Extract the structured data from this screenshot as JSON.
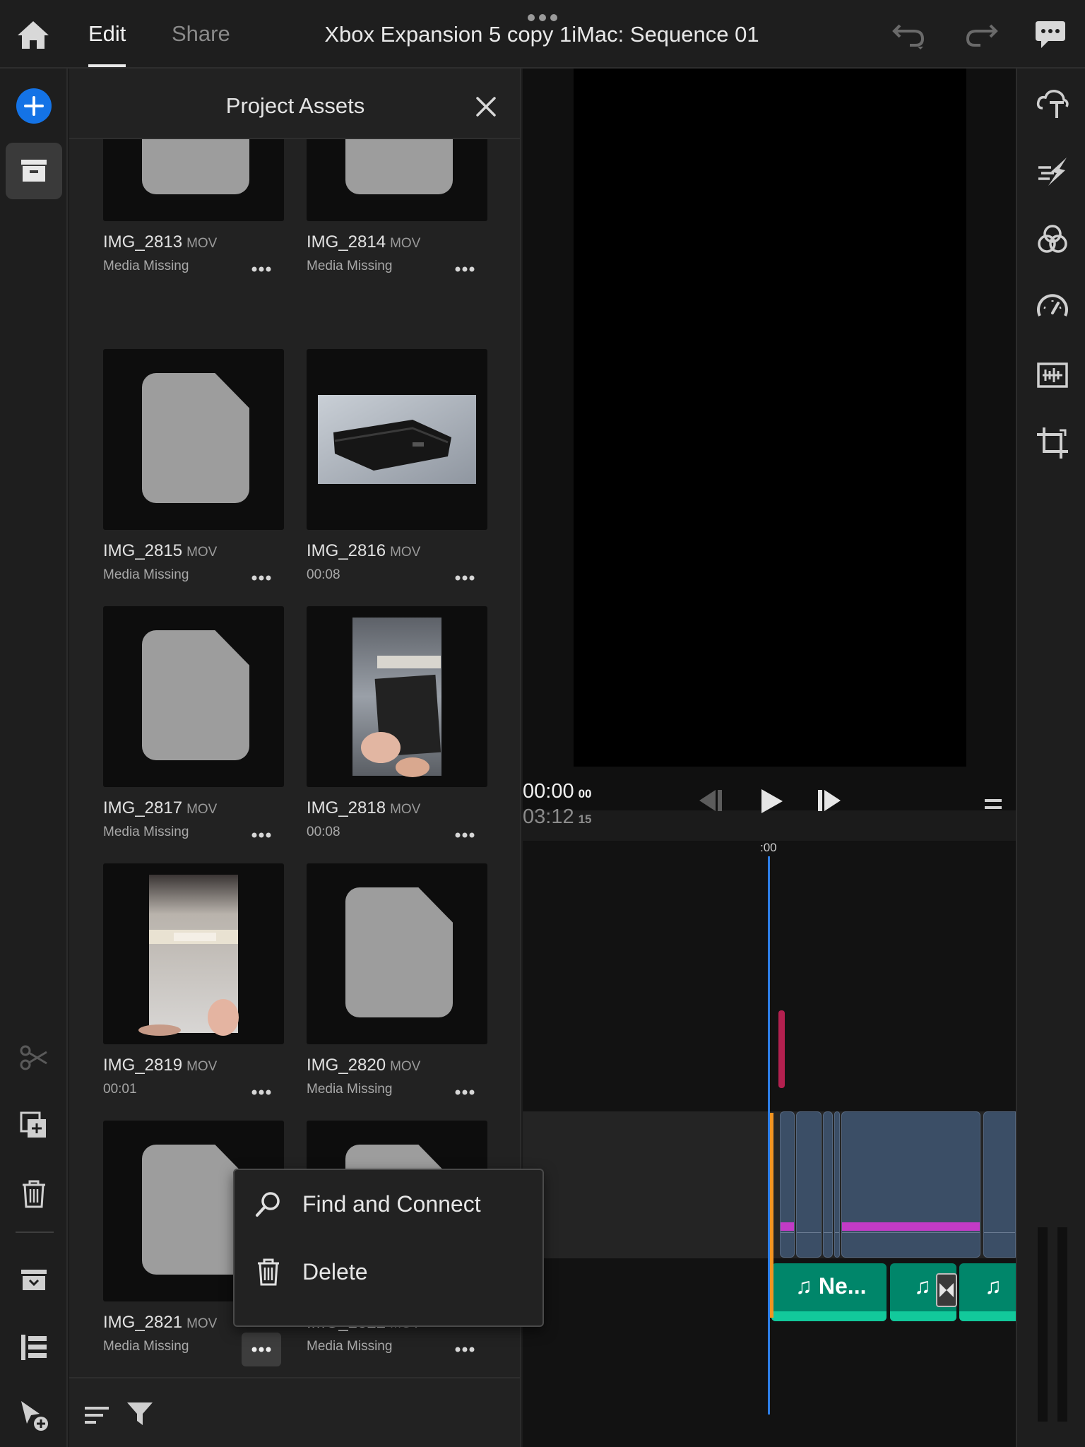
{
  "topbar": {
    "tabs": [
      {
        "label": "Edit",
        "active": true
      },
      {
        "label": "Share",
        "active": false
      }
    ],
    "title": "Xbox Expansion 5 copy 1iMac: Sequence 01",
    "icons": [
      "home-icon",
      "more-dots-icon",
      "undo-icon",
      "redo-icon",
      "feedback-icon"
    ]
  },
  "left_rail": {
    "icons": [
      "add-icon",
      "project-assets-icon",
      "split-scissors-icon",
      "duplicate-icon",
      "delete-icon",
      "collapse-tracks-icon",
      "track-list-icon",
      "select-add-icon"
    ]
  },
  "assets_panel": {
    "title": "Project Assets",
    "items": [
      {
        "name": "IMG_2813",
        "type": "MOV",
        "status": "Media Missing",
        "thumb": "missing"
      },
      {
        "name": "IMG_2814",
        "type": "MOV",
        "status": "Media Missing",
        "thumb": "missing"
      },
      {
        "name": "IMG_2815",
        "type": "MOV",
        "status": "Media Missing",
        "thumb": "missing"
      },
      {
        "name": "IMG_2816",
        "type": "MOV",
        "status": "00:08",
        "thumb": "photo-device"
      },
      {
        "name": "IMG_2817",
        "type": "MOV",
        "status": "Media Missing",
        "thumb": "missing"
      },
      {
        "name": "IMG_2818",
        "type": "MOV",
        "status": "00:08",
        "thumb": "photo-hand-card"
      },
      {
        "name": "IMG_2819",
        "type": "MOV",
        "status": "00:01",
        "thumb": "photo-white"
      },
      {
        "name": "IMG_2820",
        "type": "MOV",
        "status": "Media Missing",
        "thumb": "missing"
      },
      {
        "name": "IMG_2821",
        "type": "MOV",
        "status": "Media Missing",
        "thumb": "missing"
      },
      {
        "name": "IMG_2822",
        "type": "MOV",
        "status": "Media Missing",
        "thumb": "missing"
      }
    ],
    "footer_icons": [
      "sort-icon",
      "filter-icon"
    ]
  },
  "context_menu": {
    "items": [
      {
        "label": "Find and Connect",
        "icon": "search-icon"
      },
      {
        "label": "Delete",
        "icon": "trash-icon"
      }
    ]
  },
  "viewer": {
    "timecode_current": "00:00",
    "timecode_current_frames": "00",
    "timecode_duration": "03:12",
    "timecode_duration_frames": "15"
  },
  "timeline": {
    "ruler_label": ":00",
    "audio_clips": [
      "Ne...",
      "",
      ""
    ]
  },
  "right_rail": {
    "icons": [
      "titles-icon",
      "transitions-icon",
      "color-icon",
      "speed-icon",
      "audio-icon",
      "crop-icon"
    ]
  },
  "colors": {
    "accent_blue": "#1473e6",
    "clip_video": "#3b4e66",
    "clip_audio": "#00866a",
    "playhead": "#2d7ee6"
  }
}
